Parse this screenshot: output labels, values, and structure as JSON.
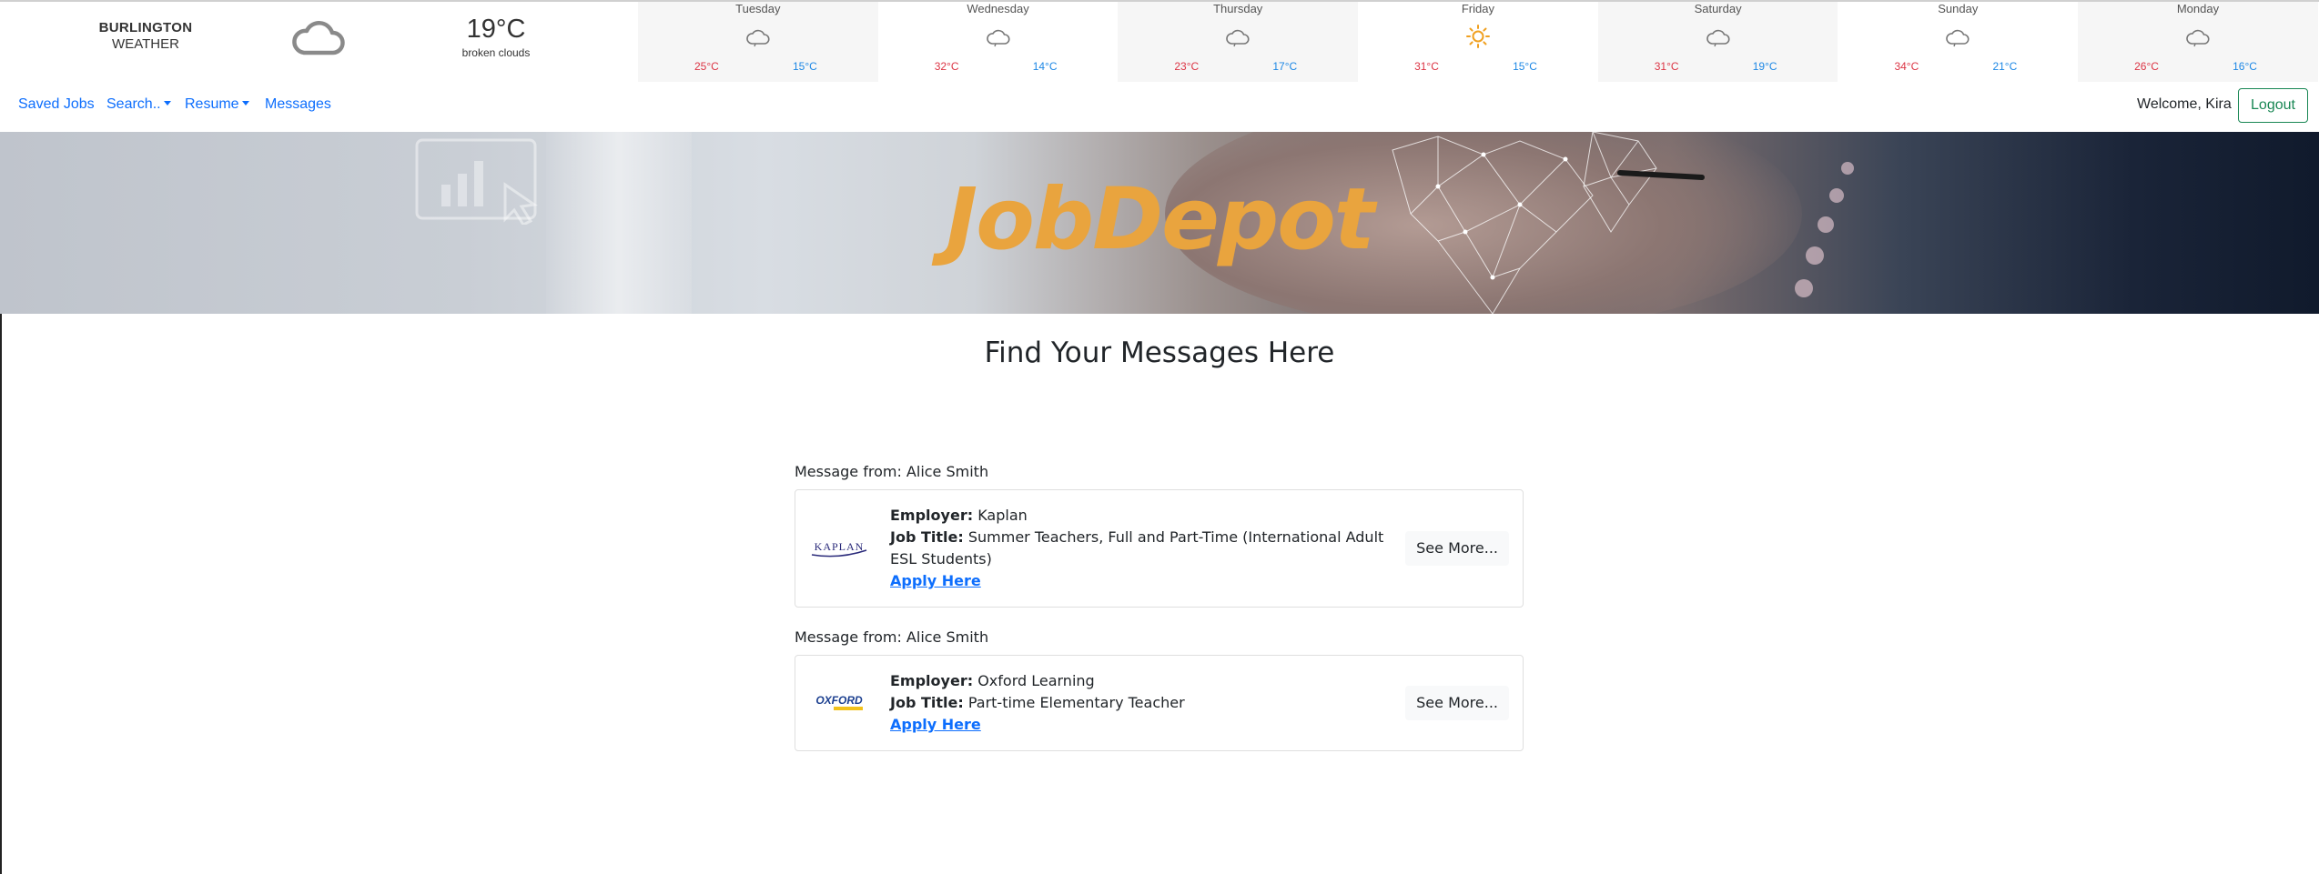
{
  "weather": {
    "city": "BURLINGTON",
    "label": "WEATHER",
    "current_temp": "19°C",
    "current_desc": "broken clouds",
    "days": [
      {
        "name": "Tuesday",
        "icon": "cloud-icon",
        "high": "25°C",
        "low": "15°C"
      },
      {
        "name": "Wednesday",
        "icon": "cloud-icon",
        "high": "32°C",
        "low": "14°C"
      },
      {
        "name": "Thursday",
        "icon": "cloud-icon",
        "high": "23°C",
        "low": "17°C"
      },
      {
        "name": "Friday",
        "icon": "sun-icon",
        "high": "31°C",
        "low": "15°C"
      },
      {
        "name": "Saturday",
        "icon": "cloud-icon",
        "high": "31°C",
        "low": "19°C"
      },
      {
        "name": "Sunday",
        "icon": "cloud-icon",
        "high": "34°C",
        "low": "21°C"
      },
      {
        "name": "Monday",
        "icon": "cloud-icon",
        "high": "26°C",
        "low": "16°C"
      }
    ]
  },
  "nav": {
    "saved_jobs": "Saved Jobs",
    "search": "Search..",
    "resume": "Resume",
    "messages": "Messages",
    "welcome": "Welcome, Kira",
    "logout": "Logout"
  },
  "banner": {
    "title": "JobDepot"
  },
  "page": {
    "title": "Find Your Messages Here"
  },
  "messages": [
    {
      "from": "Message from: Alice Smith",
      "employer_label": "Employer:",
      "employer": "Kaplan",
      "job_title_label": "Job Title:",
      "job_title": "Summer Teachers, Full and Part-Time (International Adult ESL Students)",
      "apply": "Apply Here",
      "see_more": "See More...",
      "logo_text": "KAPLAN"
    },
    {
      "from": "Message from: Alice Smith",
      "employer_label": "Employer:",
      "employer": "Oxford Learning",
      "job_title_label": "Job Title:",
      "job_title": "Part-time Elementary Teacher",
      "apply": "Apply Here",
      "see_more": "See More...",
      "logo_text": "OXFORD"
    }
  ],
  "colors": {
    "link": "#0d6efd",
    "logout_green": "#198754",
    "high_temp": "#dc3545",
    "low_temp": "#1e88e5",
    "banner_title": "#e9a43e"
  }
}
